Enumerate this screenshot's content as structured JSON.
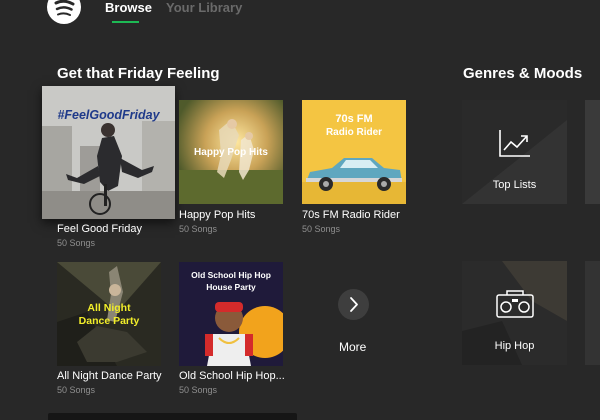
{
  "nav": {
    "logo_icon": "spotify-logo-icon",
    "tabs": [
      {
        "label": "Browse",
        "active": true
      },
      {
        "label": "Your Library",
        "active": false
      }
    ],
    "accent": "#1db954"
  },
  "friday": {
    "title": "Get that Friday Feeling",
    "playlists": [
      {
        "name": "Feel Good Friday",
        "sub": "50 Songs",
        "cover_text": "#FeelGoodFriday"
      },
      {
        "name": "Happy Pop Hits",
        "sub": "50 Songs",
        "cover_text": "Happy Pop Hits"
      },
      {
        "name": "70s FM Radio Rider",
        "sub": "50 Songs",
        "cover_text_1": "70s FM",
        "cover_text_2": "Radio Rider"
      },
      {
        "name": "All Night Dance Party",
        "sub": "50 Songs",
        "cover_text_1": "All Night",
        "cover_text_2": "Dance Party"
      },
      {
        "name": "Old School Hip Hop...",
        "sub": "50 Songs",
        "cover_text_1": "Old School Hip Hop",
        "cover_text_2": "House Party"
      }
    ],
    "more_label": "More",
    "more_icon": "chevron-right-icon"
  },
  "genres": {
    "title": "Genres & Moods",
    "items": [
      {
        "label": "Top Lists",
        "icon": "chart-trending-icon"
      },
      {
        "label": "Hip Hop",
        "icon": "boombox-icon"
      }
    ]
  }
}
